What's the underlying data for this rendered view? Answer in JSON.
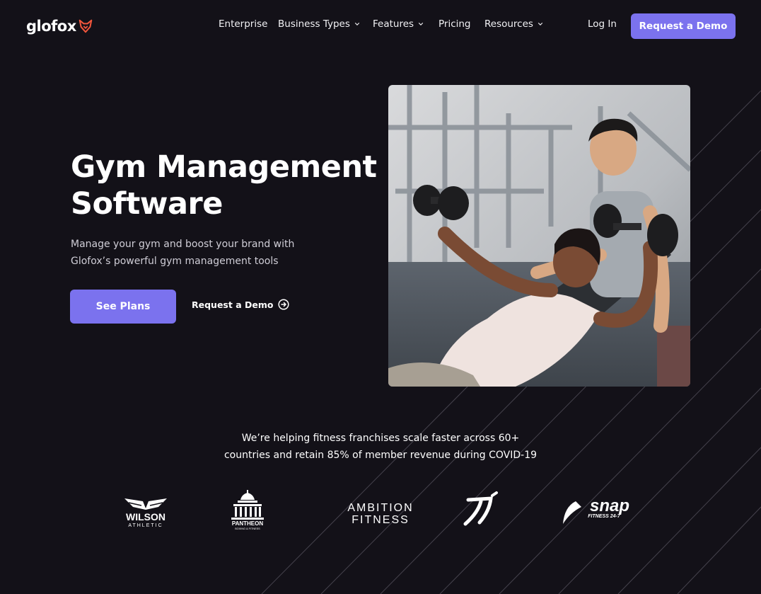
{
  "nav": {
    "logo_text": "glofox",
    "items": [
      {
        "label": "Enterprise",
        "dropdown": false
      },
      {
        "label": "Business Types",
        "dropdown": true
      },
      {
        "label": "Features",
        "dropdown": true
      },
      {
        "label": "Pricing",
        "dropdown": false
      },
      {
        "label": "Resources",
        "dropdown": true
      }
    ],
    "login_label": "Log In",
    "demo_label": "Request a Demo"
  },
  "hero": {
    "title_line1": "Gym Management",
    "title_line2": "Software",
    "subtitle": "Manage your gym and boost your brand with Glofox’s powerful gym management tools",
    "primary_cta": "See Plans",
    "secondary_cta": "Request a Demo",
    "image_alt": "trainer-spotting-woman-dumbbell-press"
  },
  "stats": {
    "text_line1": "We’re helping fitness franchises scale faster across 60+",
    "text_line2": "countries and retain 85% of member revenue during COVID-19"
  },
  "brands": {
    "wilson_main": "WILSON",
    "wilson_sub": "ATHLETIC",
    "pantheon_main": "PANTHEON",
    "pantheon_sub": "BOXING & FITNESS",
    "ambition_line1": "AMBITION",
    "ambition_line2": "FITNESS",
    "snap_main": "snap",
    "snap_sub": "FITNESS 24-7"
  },
  "colors": {
    "background": "#131118",
    "accent": "#7B72EE",
    "logo_fox": "#F2563C"
  }
}
